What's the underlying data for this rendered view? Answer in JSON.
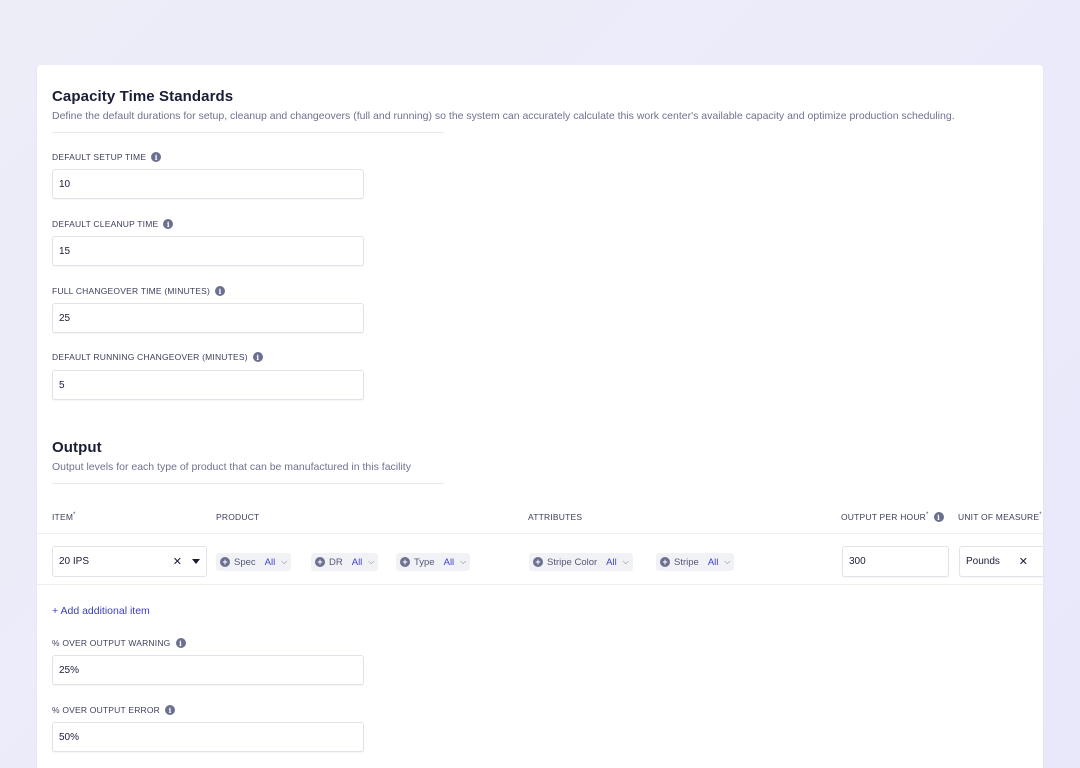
{
  "capacity": {
    "title": "Capacity Time Standards",
    "description": "Define the default durations for setup, cleanup and changeovers (full and running) so the system can accurately calculate this work center's available capacity and optimize production scheduling.",
    "fields": [
      {
        "label": "DEFAULT SETUP TIME",
        "value": "10"
      },
      {
        "label": "DEFAULT CLEANUP TIME",
        "value": "15"
      },
      {
        "label": "FULL CHANGEOVER TIME (MINUTES)",
        "value": "25"
      },
      {
        "label": "DEFAULT RUNNING CHANGEOVER (MINUTES)",
        "value": "5"
      }
    ]
  },
  "output": {
    "title": "Output",
    "description": "Output levels for each type of product that can be manufactured in this facility",
    "columns": {
      "item": "ITEM",
      "product": "PRODUCT",
      "attributes": "ATTRIBUTES",
      "output_per_hour": "OUTPUT PER HOUR",
      "unit_of_measure": "UNIT OF MEASURE"
    },
    "required_mark": "*",
    "row": {
      "item_value": "20 IPS",
      "product_filters": [
        {
          "name": "Spec",
          "value": "All"
        },
        {
          "name": "DR",
          "value": "All"
        },
        {
          "name": "Type",
          "value": "All"
        }
      ],
      "attribute_filters": [
        {
          "name": "Stripe Color",
          "value": "All"
        },
        {
          "name": "Stripe",
          "value": "All"
        }
      ],
      "output_per_hour": "300",
      "unit_of_measure": "Pounds"
    },
    "add_item_label": "+ Add additional item",
    "warning": {
      "label": "% OVER OUTPUT WARNING",
      "value": "25%"
    },
    "error": {
      "label": "% OVER OUTPUT ERROR",
      "value": "50%"
    }
  },
  "icons": {
    "info": "info-icon",
    "plus": "plus-circle-icon",
    "chevron": "chevron-down-icon",
    "caret": "caret-down-icon",
    "clear": "close-icon"
  },
  "colors": {
    "accent": "#3b3bcc",
    "text": "#1a1d38",
    "muted": "#6f7291",
    "background": "#ebebfa"
  }
}
